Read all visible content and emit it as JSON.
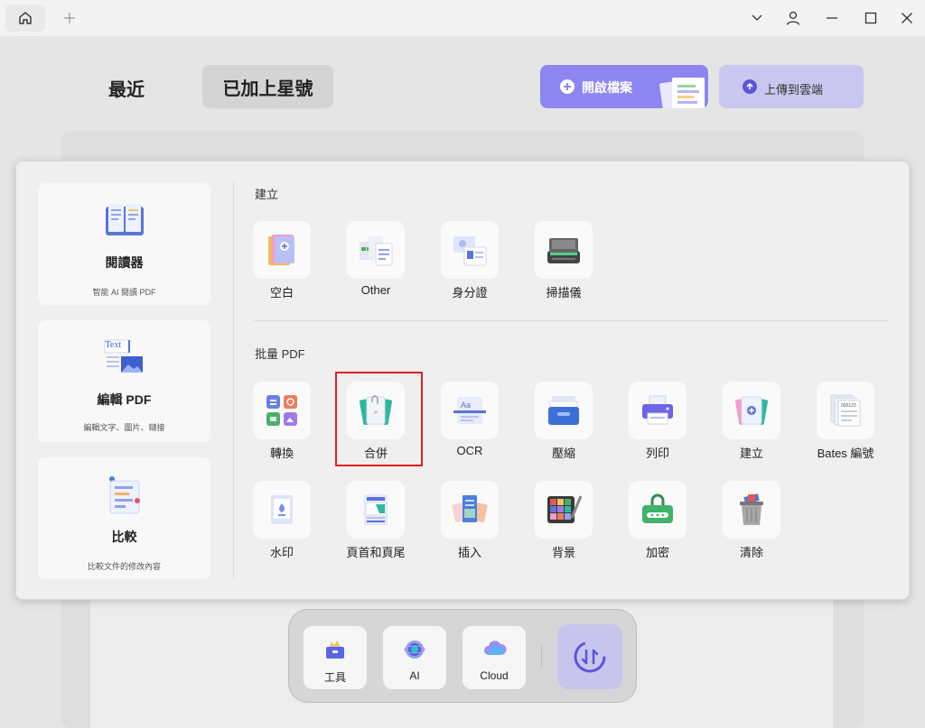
{
  "header": {
    "tabs": [
      "最近",
      "已加上星號"
    ],
    "open_file_label": "開啟檔案",
    "upload_cloud_label": "上傳到雲端"
  },
  "popup": {
    "cards": [
      {
        "title": "閱讀器",
        "subtitle": "智能 AI 閱讀 PDF"
      },
      {
        "title": "編輯 PDF",
        "subtitle": "編輯文字、圖片、鏈接",
        "icon_text": "Text"
      },
      {
        "title": "比較",
        "subtitle": "比較文件的修改內容"
      }
    ],
    "create_section": {
      "label": "建立",
      "items": [
        "空白",
        "Other",
        "身分證",
        "掃描儀"
      ]
    },
    "batch_section": {
      "label": "批量 PDF",
      "row1": [
        "轉換",
        "合併",
        "OCR",
        "壓縮",
        "列印",
        "建立",
        "Bates 編號"
      ],
      "row2": [
        "水印",
        "頁首和頁尾",
        "插入",
        "背景",
        "加密",
        "清除"
      ]
    },
    "highlighted_item": "合併"
  },
  "dock": {
    "items": [
      "工具",
      "AI",
      "Cloud"
    ]
  },
  "colors": {
    "accent": "#8d86f0",
    "highlight_border": "#e02020"
  }
}
